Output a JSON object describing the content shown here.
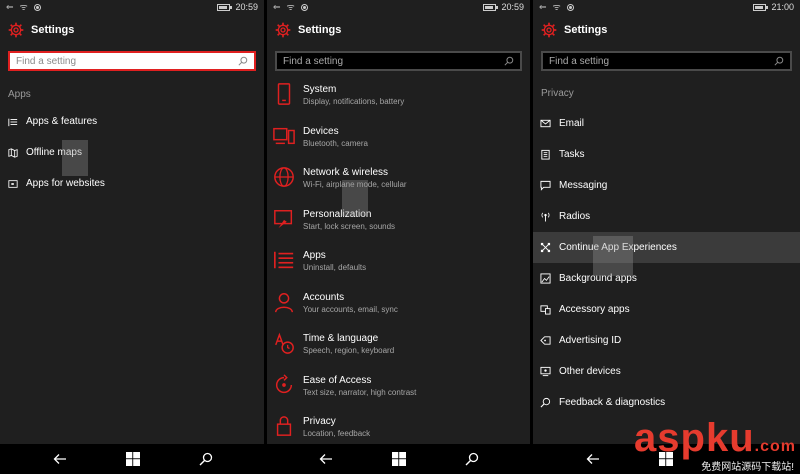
{
  "accent": "#e02020",
  "screens": [
    {
      "status_time": "20:59",
      "title": "Settings",
      "search_placeholder": "Find a setting",
      "section": "Apps",
      "items": [
        {
          "label": "Apps & features",
          "icon": "list-icon"
        },
        {
          "label": "Offline maps",
          "icon": "map-icon"
        },
        {
          "label": "Apps for websites",
          "icon": "website-icon"
        }
      ]
    },
    {
      "status_time": "20:59",
      "title": "Settings",
      "search_placeholder": "Find a setting",
      "items": [
        {
          "label": "System",
          "sub": "Display, notifications, battery",
          "icon": "phone-icon"
        },
        {
          "label": "Devices",
          "sub": "Bluetooth, camera",
          "icon": "devices-icon"
        },
        {
          "label": "Network & wireless",
          "sub": "Wi-Fi, airplane mode, cellular",
          "icon": "globe-icon"
        },
        {
          "label": "Personalization",
          "sub": "Start, lock screen, sounds",
          "icon": "paint-icon"
        },
        {
          "label": "Apps",
          "sub": "Uninstall, defaults",
          "icon": "list-icon"
        },
        {
          "label": "Accounts",
          "sub": "Your accounts, email, sync",
          "icon": "person-icon"
        },
        {
          "label": "Time & language",
          "sub": "Speech, region, keyboard",
          "icon": "time-language-icon"
        },
        {
          "label": "Ease of Access",
          "sub": "Text size, narrator, high contrast",
          "icon": "ease-of-access-icon"
        },
        {
          "label": "Privacy",
          "sub": "Location, feedback",
          "icon": "lock-icon"
        }
      ]
    },
    {
      "status_time": "21:00",
      "title": "Settings",
      "search_placeholder": "Find a setting",
      "section": "Privacy",
      "items": [
        {
          "label": "Email",
          "icon": "mail-icon"
        },
        {
          "label": "Tasks",
          "icon": "tasks-icon"
        },
        {
          "label": "Messaging",
          "icon": "message-icon"
        },
        {
          "label": "Radios",
          "icon": "radio-icon"
        },
        {
          "label": "Continue App Experiences",
          "icon": "continue-icon",
          "selected": true
        },
        {
          "label": "Background apps",
          "icon": "background-apps-icon"
        },
        {
          "label": "Accessory apps",
          "icon": "accessory-icon"
        },
        {
          "label": "Advertising ID",
          "icon": "tag-icon"
        },
        {
          "label": "Other devices",
          "icon": "other-devices-icon"
        },
        {
          "label": "Feedback & diagnostics",
          "icon": "feedback-icon"
        }
      ]
    }
  ],
  "taskbar": [
    "back-icon",
    "windows-icon",
    "search-icon"
  ],
  "watermark": {
    "brand_a": "asp",
    "brand_b": "ku",
    "domain": ".com",
    "caption": "免费网站源码下载站!"
  }
}
